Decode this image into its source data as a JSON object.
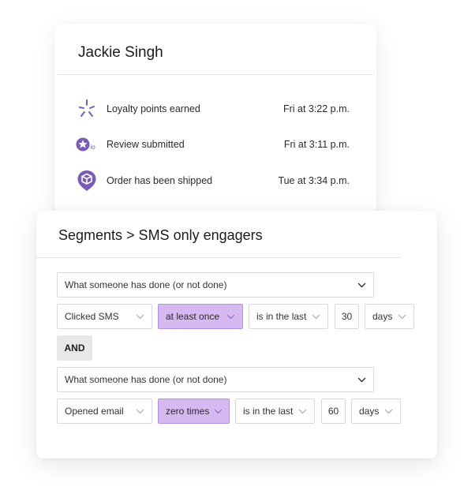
{
  "profile": {
    "name": "Jackie Singh",
    "activities": [
      {
        "icon": "sparkle-burst-icon",
        "label": "Loyalty points earned",
        "time": "Fri at 3:22 p.m."
      },
      {
        "icon": "star-io-icon",
        "icon_text": "io",
        "label": "Review submitted",
        "time": "Fri at 3:11 p.m."
      },
      {
        "icon": "shipping-box-pin-icon",
        "label": "Order has been shipped",
        "time": "Tue at 3:34 p.m."
      }
    ]
  },
  "segment": {
    "title": "Segments > SMS only engagers",
    "conditions": [
      {
        "definition": "What someone has done (or not done)",
        "metric": "Clicked SMS",
        "frequency": "at least once",
        "timeframe": "is in the last",
        "amount": "30",
        "unit": "days"
      },
      {
        "definition": "What someone has done (or not done)",
        "metric": "Opened email",
        "frequency": "zero times",
        "timeframe": "is in the last",
        "amount": "60",
        "unit": "days"
      }
    ],
    "operator": "AND"
  },
  "colors": {
    "accent_purple": "#7a5bb5",
    "highlight_fill": "#d7b9f2",
    "highlight_border": "#b88fe3"
  }
}
